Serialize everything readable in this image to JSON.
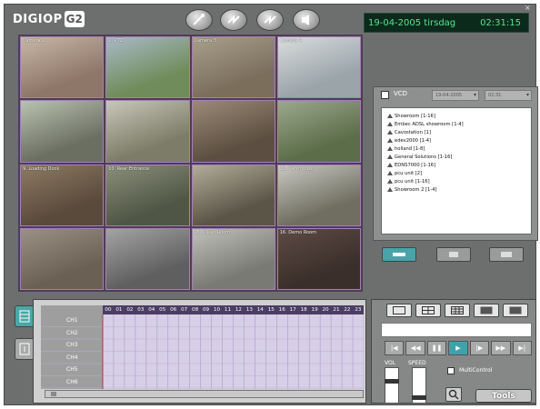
{
  "app": {
    "logo_text": "DIGIOP",
    "logo_mark": "G2",
    "date": "19-04-2005 tirsdag",
    "time": "02:31:15",
    "header_buttons": [
      "wand-icon",
      "spark-icon",
      "spark-icon",
      "speaker-icon"
    ]
  },
  "cameras": [
    {
      "label": "Camera 1",
      "colors": [
        "#8e7668",
        "#c7b7a7"
      ]
    },
    {
      "label": "2. PTZ",
      "colors": [
        "#6f8c5a",
        "#a9b9c6"
      ]
    },
    {
      "label": "Camera 3",
      "colors": [
        "#7b6f5c",
        "#a89f8c"
      ]
    },
    {
      "label": "Camera 4",
      "colors": [
        "#9aa4a9",
        "#d9dcdc"
      ]
    },
    {
      "label": "",
      "colors": [
        "#6b6f62",
        "#b9c2b0"
      ]
    },
    {
      "label": "",
      "colors": [
        "#7d7c68",
        "#c7c6b9"
      ]
    },
    {
      "label": "",
      "colors": [
        "#5c4f41",
        "#9c8a77"
      ]
    },
    {
      "label": "",
      "colors": [
        "#5c6d49",
        "#9aa98d"
      ]
    },
    {
      "label": "9. Loading Dock",
      "colors": [
        "#5a4a3b",
        "#8c7a63"
      ]
    },
    {
      "label": "10. Rear Entrance",
      "colors": [
        "#4f5645",
        "#8a8f7a"
      ]
    },
    {
      "label": "",
      "colors": [
        "#5a5547",
        "#b2ad99"
      ]
    },
    {
      "label": "12. Parking Lot",
      "colors": [
        "#6f6e60",
        "#c9c8c2"
      ]
    },
    {
      "label": "",
      "colors": [
        "#6a6053",
        "#9a9085"
      ]
    },
    {
      "label": "",
      "colors": [
        "#5f5f5f",
        "#a3a3a3"
      ]
    },
    {
      "label": "15. Clean Room",
      "colors": [
        "#7a7a75",
        "#c0c0bb"
      ]
    },
    {
      "label": "16. Demo Room",
      "colors": [
        "#3a2f2a",
        "#5e4a44"
      ]
    }
  ],
  "vcd": {
    "label": "VCD",
    "select1": "19-04-2005",
    "select2": "02:31",
    "tree": [
      "Showroom [1-16]",
      "Embec ADSL showroom [1-4]",
      "Cavostation [1]",
      "edev2000 [1-4]",
      "holland [1-8]",
      "General Solutions [1-16]",
      "EDNS7000 [1-16]",
      "pcu unit [2]",
      "pcu unit [1-16]",
      "Showroom 2 [1-4]"
    ]
  },
  "timeline": {
    "hours": [
      "00",
      "01",
      "02",
      "03",
      "04",
      "05",
      "06",
      "07",
      "08",
      "09",
      "10",
      "11",
      "12",
      "13",
      "14",
      "15",
      "16",
      "17",
      "18",
      "19",
      "20",
      "21",
      "22",
      "23"
    ],
    "channels": [
      "CH1",
      "CH2",
      "CH3",
      "CH4",
      "CH5",
      "CH6"
    ]
  },
  "controls": {
    "vol_label": "VOL",
    "speed_label": "SPEED",
    "multicontrol_label": "MultiControl",
    "tools_label": "Tools",
    "playback": [
      "|◀",
      "◀◀",
      "❚❚",
      "▶",
      "|▶",
      "▶▶",
      "▶|"
    ]
  },
  "colors": {
    "frame": "#6d6f6f",
    "accent": "#49a3a9",
    "grid_border": "#a77fb8",
    "clock_text": "#57e38f"
  }
}
